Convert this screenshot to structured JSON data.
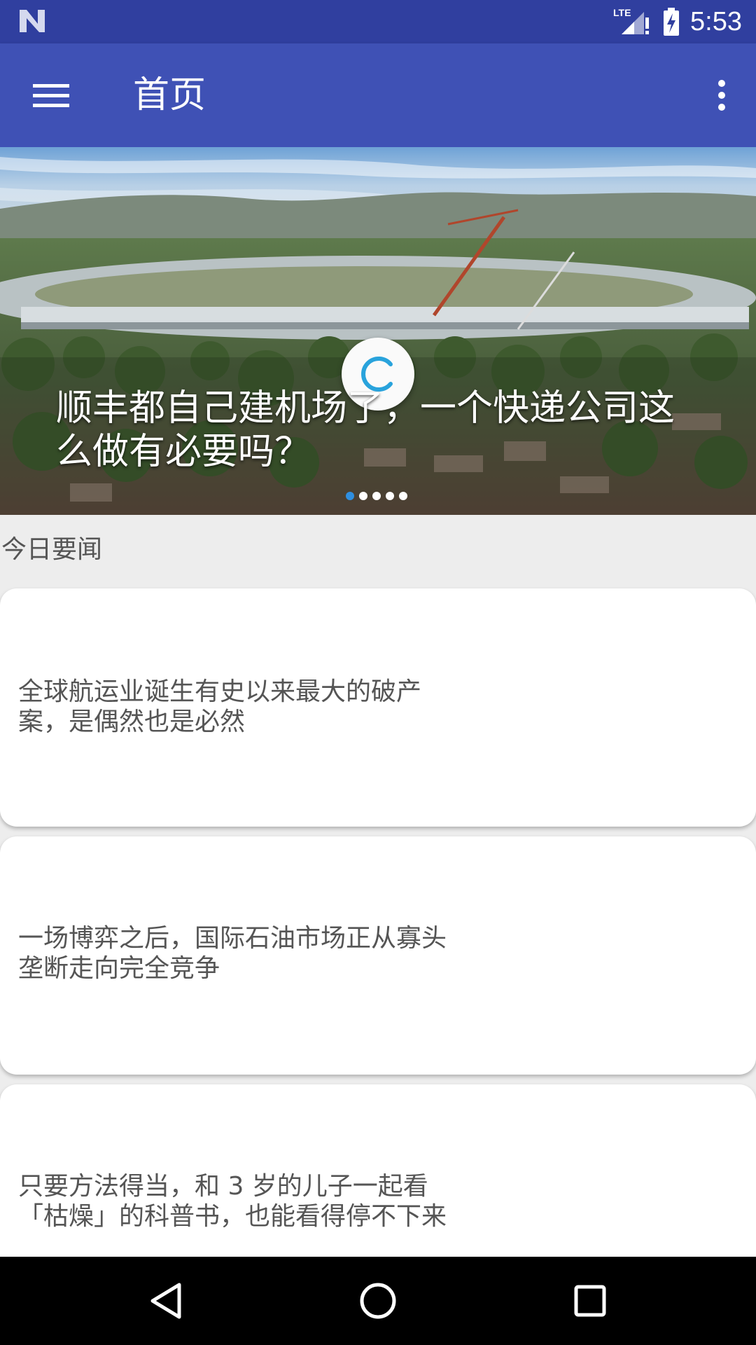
{
  "status_bar": {
    "network": "LTE",
    "time": "5:53"
  },
  "app_bar": {
    "title": "首页",
    "menu_icon": "hamburger-menu-icon",
    "overflow_icon": "more-vertical-icon"
  },
  "banner": {
    "title": "顺丰都自己建机场了，一个快递公司这么做有必要吗？",
    "page_count": 5,
    "active_page": 1
  },
  "section": {
    "label": "今日要闻"
  },
  "stories": [
    {
      "title_line1": "全球航运业诞生有史以来最大的破产",
      "title_line2": "案，是偶然也是必然"
    },
    {
      "title_line1": "一场博弈之后，国际石油市场正从寡头",
      "title_line2": "垄断走向完全竞争"
    },
    {
      "title_line1": "只要方法得当，和 3 岁的儿子一起看",
      "title_line2": "「枯燥」的科普书，也能看得停不下来"
    }
  ],
  "nav_bar": {
    "back_icon": "back-triangle-icon",
    "home_icon": "home-circle-icon",
    "recents_icon": "recents-square-icon"
  },
  "colors": {
    "status_bar": "#303f9f",
    "app_bar": "#3f51b5",
    "accent": "#2f8fe0"
  }
}
